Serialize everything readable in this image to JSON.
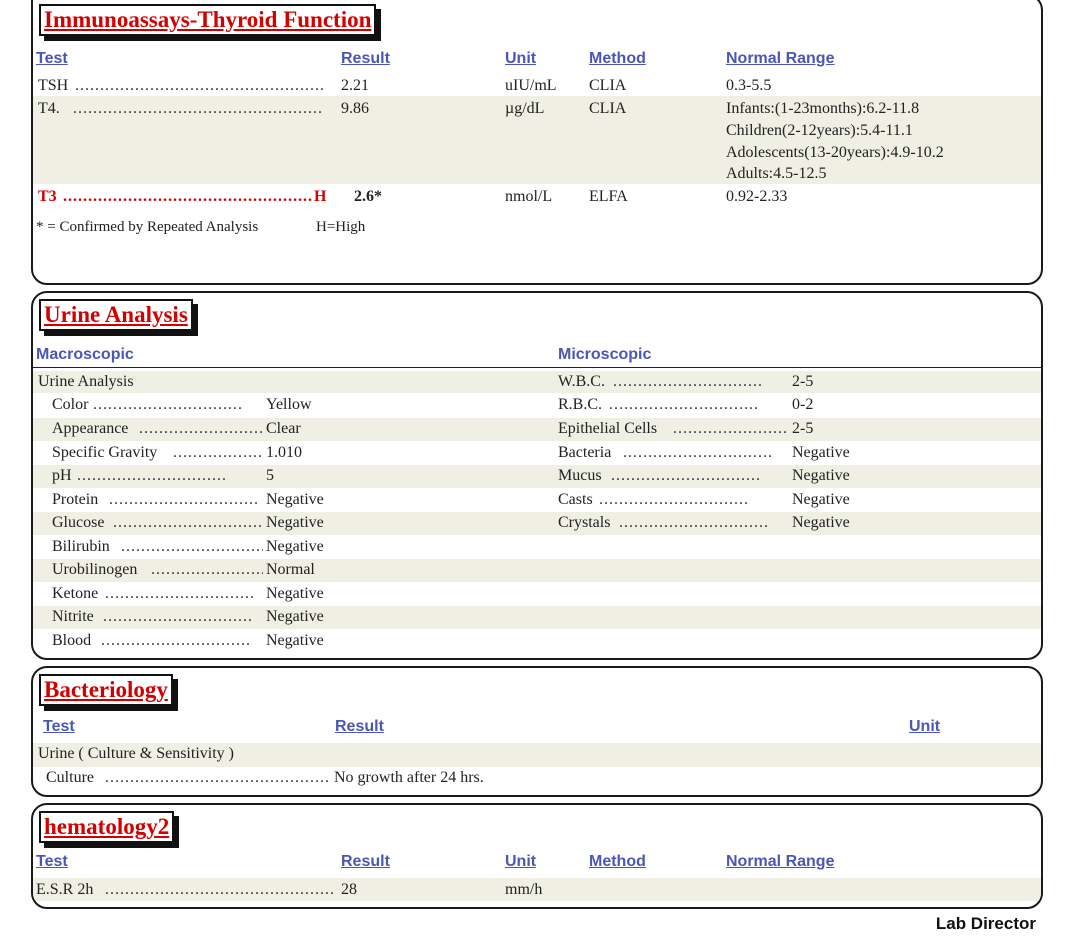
{
  "thyroid": {
    "title": "Immunoassays-Thyroid Function",
    "headers": {
      "test": "Test",
      "result": "Result",
      "unit": "Unit",
      "method": "Method",
      "range": "Normal Range"
    },
    "rows": [
      {
        "test": "TSH",
        "result": "2.21",
        "unit": "uIU/mL",
        "method": "CLIA",
        "range": [
          "0.3-5.5"
        ]
      },
      {
        "test": "T4.",
        "result": "9.86",
        "unit": "µg/dL",
        "method": "CLIA",
        "range": [
          "Infants:(1-23months):6.2-11.8",
          "Children(2-12years):5.4-11.1",
          "Adolescents(13-20years):4.9-10.2",
          "Adults:4.5-12.5"
        ]
      },
      {
        "test": "T3",
        "flag": "H",
        "result": "2.6*",
        "unit": "nmol/L",
        "method": "ELFA",
        "range": [
          "0.92-2.33"
        ]
      }
    ],
    "footnote": "* = Confirmed by Repeated Analysis",
    "legend": "H=High"
  },
  "urine": {
    "title": "Urine Analysis",
    "macro_header": "Macroscopic",
    "micro_header": "Microscopic",
    "group_label": "Urine Analysis",
    "macro": [
      {
        "test": "Color",
        "result": "Yellow"
      },
      {
        "test": "Appearance",
        "result": "Clear"
      },
      {
        "test": "Specific Gravity",
        "result": "1.010"
      },
      {
        "test": "pH",
        "result": "5"
      },
      {
        "test": "Protein",
        "result": "Negative"
      },
      {
        "test": "Glucose",
        "result": "Negative"
      },
      {
        "test": "Bilirubin",
        "result": "Negative"
      },
      {
        "test": "Urobilinogen",
        "result": "Normal"
      },
      {
        "test": "Ketone",
        "result": "Negative"
      },
      {
        "test": "Nitrite",
        "result": "Negative"
      },
      {
        "test": "Blood",
        "result": "Negative"
      }
    ],
    "micro": [
      {
        "test": "W.B.C.",
        "result": "2-5"
      },
      {
        "test": "R.B.C.",
        "result": "0-2"
      },
      {
        "test": "Epithelial Cells",
        "result": "2-5"
      },
      {
        "test": "Bacteria",
        "result": "Negative"
      },
      {
        "test": "Mucus",
        "result": "Negative"
      },
      {
        "test": "Casts",
        "result": "Negative"
      },
      {
        "test": "Crystals",
        "result": "Negative"
      }
    ]
  },
  "bacteriology": {
    "title": "Bacteriology",
    "headers": {
      "test": "Test",
      "result": "Result",
      "unit": "Unit"
    },
    "group_label": "Urine ( Culture & Sensitivity )",
    "rows": [
      {
        "test": "Culture",
        "result": "No growth after 24 hrs."
      }
    ]
  },
  "hematology": {
    "title": "hematology2",
    "headers": {
      "test": "Test",
      "result": "Result",
      "unit": "Unit",
      "method": "Method",
      "range": "Normal Range"
    },
    "rows": [
      {
        "test": "E.S.R 2h",
        "result": "28",
        "unit": "mm/h"
      }
    ]
  },
  "footer": {
    "signature_label": "Lab Director"
  }
}
